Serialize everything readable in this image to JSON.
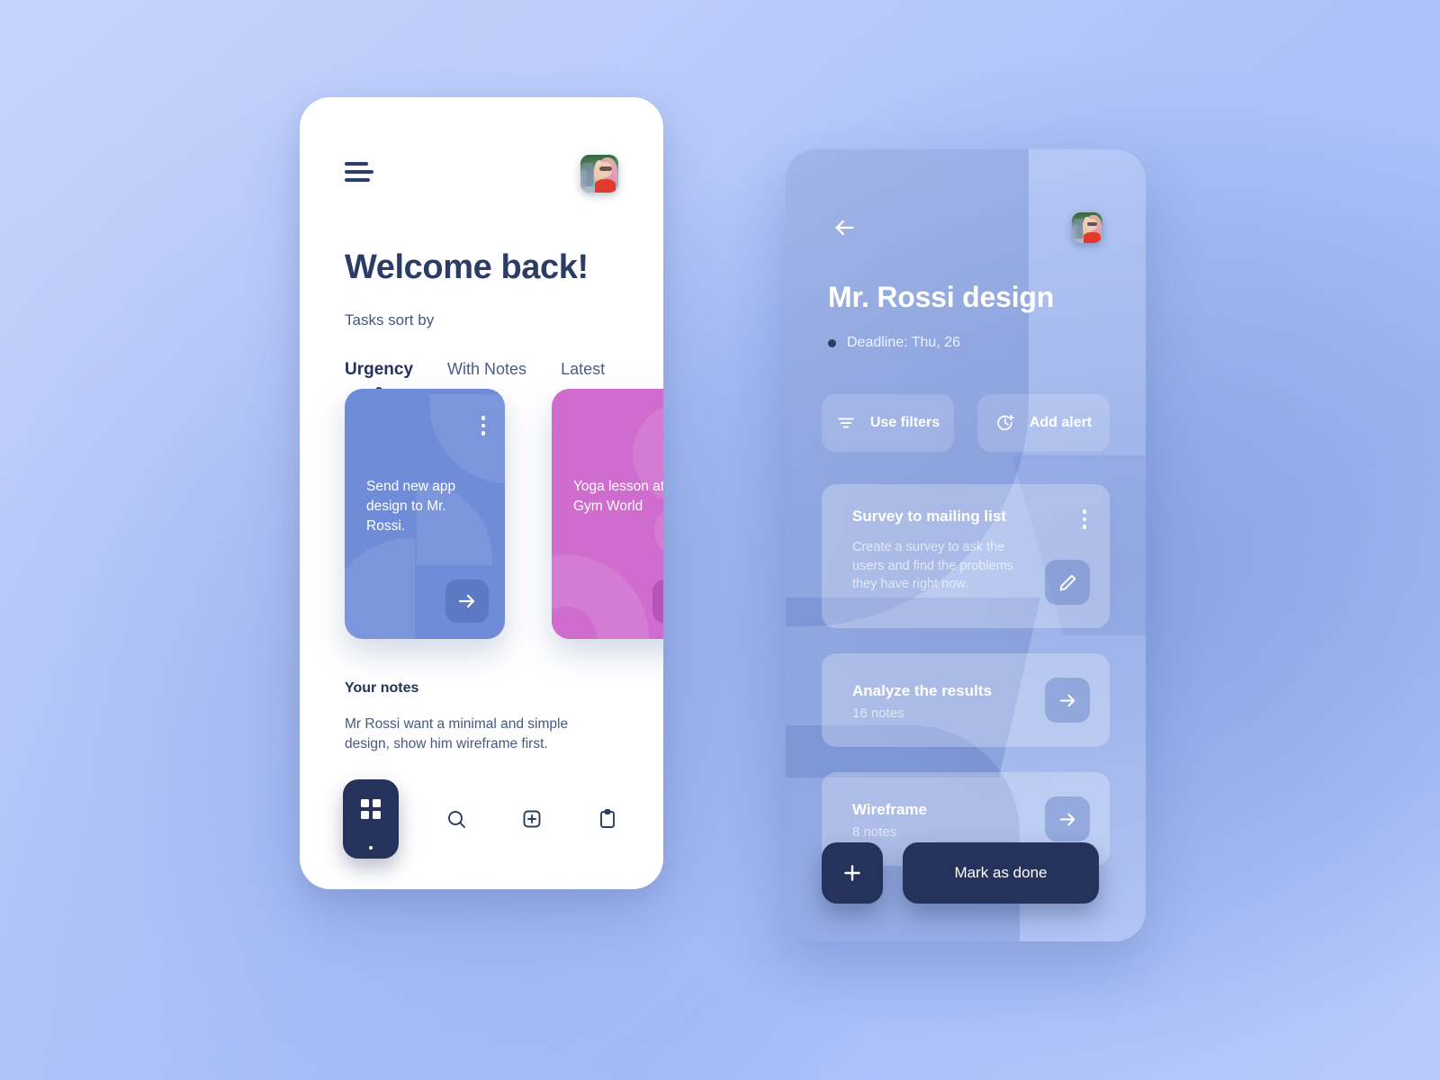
{
  "theme": {
    "bg_gradient_from": "#c5d3fd",
    "bg_gradient_to": "#a5bcf6",
    "navy": "#25335c",
    "card_blue": "#6e8cd8",
    "card_pink": "#cf6cce",
    "text_navy": "#2b3c66"
  },
  "home_screen": {
    "menu_icon": "hamburger-menu-icon",
    "avatar": "user-avatar",
    "title": "Welcome back!",
    "subtitle": "Tasks sort by",
    "tabs": [
      {
        "label": "Urgency",
        "active": true
      },
      {
        "label": "With Notes",
        "active": false
      },
      {
        "label": "Latest",
        "active": false
      }
    ],
    "task_cards": [
      {
        "title": "Send new app design to Mr. Rossi.",
        "color": "#6e8cd8",
        "menu_icon": "more-vertical-icon",
        "action_icon": "arrow-right-icon"
      },
      {
        "title": "Yoga lesson at Gym World",
        "color": "#cf6cce",
        "menu_icon": "more-vertical-icon",
        "action_icon": "arrow-right-icon"
      }
    ],
    "notes": {
      "heading": "Your notes",
      "body": "Mr Rossi want a minimal and simple design, show him wireframe first."
    },
    "bottom_nav": [
      {
        "icon": "grid-icon",
        "active": true
      },
      {
        "icon": "search-icon",
        "active": false
      },
      {
        "icon": "plus-square-icon",
        "active": false
      },
      {
        "icon": "clipboard-icon",
        "active": false
      }
    ]
  },
  "detail_screen": {
    "back_icon": "arrow-left-icon",
    "avatar": "user-avatar",
    "title": "Mr. Rossi design",
    "deadline": "Deadline: Thu, 26",
    "actions": [
      {
        "label": "Use filters",
        "icon": "filter-icon"
      },
      {
        "label": "Add alert",
        "icon": "clock-plus-icon"
      }
    ],
    "tasks": [
      {
        "title": "Survey to mailing list",
        "description": "Create a survey to ask the users and find the problems they have right now.",
        "menu_icon": "more-vertical-icon",
        "action_icon": "pencil-icon"
      },
      {
        "title": "Analyze the results",
        "meta": "16 notes",
        "action_icon": "arrow-right-icon"
      },
      {
        "title": "Wireframe",
        "meta": "8 notes",
        "action_icon": "arrow-right-icon"
      }
    ],
    "footer": {
      "add_icon": "plus-icon",
      "done_label": "Mark as done"
    }
  }
}
